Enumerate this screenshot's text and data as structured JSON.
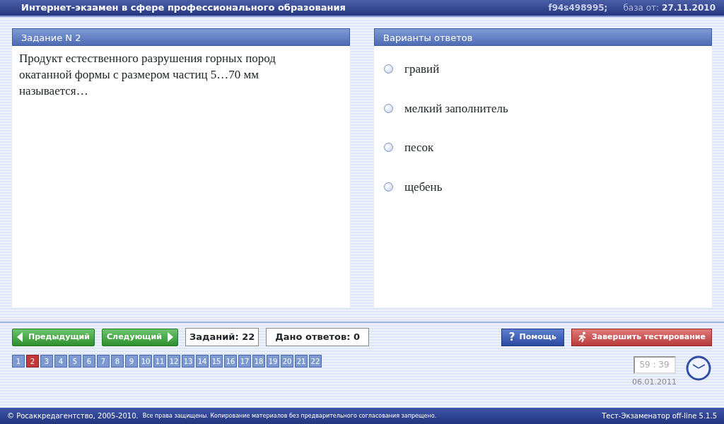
{
  "window": {
    "title": "Интернет-экзамен в сфере профессионального образования",
    "code": "f94s498995;",
    "base_label": "база от:",
    "base_date": "27.11.2010"
  },
  "question": {
    "header": "Задание N 2",
    "text": "Продукт естественного разрушения горных пород окатанной формы с размером частиц 5…70 мм называется…"
  },
  "answers": {
    "header": "Варианты ответов",
    "options": [
      {
        "label": "гравий",
        "selected": false
      },
      {
        "label": "мелкий заполнитель",
        "selected": false
      },
      {
        "label": "песок",
        "selected": false
      },
      {
        "label": "щебень",
        "selected": false
      }
    ]
  },
  "nav": {
    "prev": "Предыдущий",
    "next": "Следующий",
    "tasks": "Заданий: 22",
    "answered": "Дано ответов: 0",
    "help": "Помощь",
    "help_icon": "?",
    "finish": "Завершить тестирование"
  },
  "pages": [
    {
      "label": "1",
      "selected": false
    },
    {
      "label": "2",
      "selected": true
    },
    {
      "label": "3",
      "selected": false
    },
    {
      "label": "4",
      "selected": false
    },
    {
      "label": "5",
      "selected": false
    },
    {
      "label": "6",
      "selected": false
    },
    {
      "label": "7",
      "selected": false
    },
    {
      "label": "8",
      "selected": false
    },
    {
      "label": "9",
      "selected": false
    },
    {
      "label": "10",
      "selected": false
    },
    {
      "label": "11",
      "selected": false
    },
    {
      "label": "12",
      "selected": false
    },
    {
      "label": "13",
      "selected": false
    },
    {
      "label": "14",
      "selected": false
    },
    {
      "label": "15",
      "selected": false
    },
    {
      "label": "16",
      "selected": false
    },
    {
      "label": "17",
      "selected": false
    },
    {
      "label": "18",
      "selected": false
    },
    {
      "label": "19",
      "selected": false
    },
    {
      "label": "20",
      "selected": false
    },
    {
      "label": "21",
      "selected": false
    },
    {
      "label": "22",
      "selected": false
    }
  ],
  "timer": {
    "time": "59 : 39",
    "date": "06.01.2011"
  },
  "status_bar": {
    "copyright": "© Росаккредагентство, 2005-2010.",
    "notice": "Все права защищены. Копирование материалов без предварительного согласования запрещено.",
    "version": "Тест-Экзаменатор off-line 5.1.5"
  }
}
